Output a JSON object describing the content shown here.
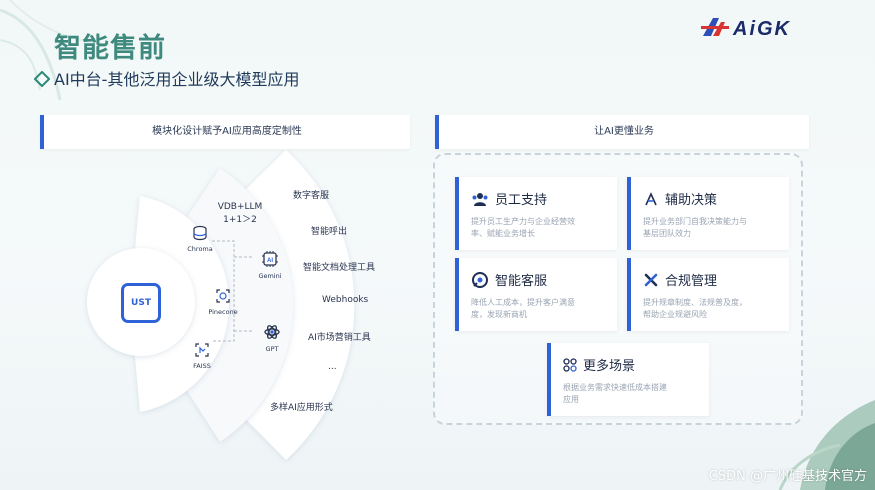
{
  "header": {
    "title": "智能售前",
    "subtitle": "AI中台-其他泛用企业级大模型应用",
    "logo_text": "AiGK"
  },
  "left_section": {
    "bar_label": "模块化设计赋予AI应用高度定制性",
    "core_label": "UST",
    "middle": {
      "title_line1": "VDB+LLM",
      "title_line2": "1+1＞2",
      "vdb": [
        {
          "label": "Chroma",
          "icon": "database-icon"
        },
        {
          "label": "Pinecone",
          "icon": "pinecone-icon"
        },
        {
          "label": "FAISS",
          "icon": "faiss-icon"
        }
      ],
      "llm": [
        {
          "label": "Gemini",
          "icon": "ai-chip-icon"
        },
        {
          "label": "GPT",
          "icon": "openai-icon"
        }
      ]
    },
    "outer_items": [
      "数字客服",
      "智能呼出",
      "智能文档处理工具",
      "Webhooks",
      "AI市场营销工具",
      "...",
      "多样AI应用形式"
    ]
  },
  "right_section": {
    "bar_label": "让AI更懂业务",
    "cards": [
      {
        "title": "员工支持",
        "icon": "people-icon",
        "desc_line1": "提升员工生产力与企业经营效",
        "desc_line2": "率、赋能业务增长"
      },
      {
        "title": "辅助决策",
        "icon": "decision-icon",
        "desc_line1": "提升业务部门自我决策能力与",
        "desc_line2": "基层团队效力"
      },
      {
        "title": "智能客服",
        "icon": "chat-icon",
        "desc_line1": "降低人工成本，提升客户满意",
        "desc_line2": "度，发现新商机"
      },
      {
        "title": "合规管理",
        "icon": "tools-icon",
        "desc_line1": "提升规章制度、法规普及度，",
        "desc_line2": "帮助企业规避风险"
      },
      {
        "title": "更多场景",
        "icon": "grid-icon",
        "desc_line1": "根据业务需求快速低成本搭建",
        "desc_line2": "应用"
      }
    ]
  },
  "watermark": "CSDN @广州硅基技术官方",
  "colors": {
    "accent": "#2f62d8",
    "title": "#3f8a7f",
    "text": "#1e2b45"
  }
}
